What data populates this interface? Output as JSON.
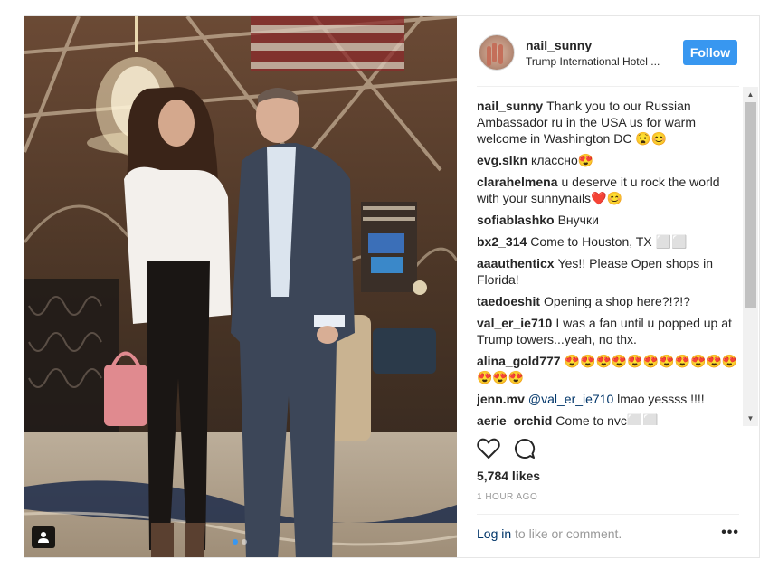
{
  "post": {
    "username": "nail_sunny",
    "location": "Trump International Hotel ...",
    "follow_label": "Follow",
    "likes": "5,784 likes",
    "timestamp": "1 HOUR AGO",
    "login_link": "Log in",
    "login_rest": " to like or comment.",
    "more_label": "•••"
  },
  "comments": [
    {
      "user": "nail_sunny",
      "text": "Thank you to our Russian Ambassador ru in the USA us for warm welcome in Washington DC 😧😊"
    },
    {
      "user": "evg.slkn",
      "text": "классно😍"
    },
    {
      "user": "clarahelmena",
      "text": "u deserve it u rock the world with your sunnynails❤️😊"
    },
    {
      "user": "sofiablashko",
      "text": "Внучки"
    },
    {
      "user": "bx2_314",
      "text": "Come to Houston, TX ⬜⬜"
    },
    {
      "user": "aaauthenticx",
      "text": "Yes!! Please Open shops in Florida!"
    },
    {
      "user": "taedoeshit",
      "text": "Opening a shop here?!?!?"
    },
    {
      "user": "val_er_ie710",
      "text": "I was a fan until u popped up at Trump towers...yeah, no thx."
    },
    {
      "user": "alina_gold777",
      "text": "😍😍😍😍😍😍😍😍😍😍😍😍😍😍"
    },
    {
      "user": "jenn.mv",
      "mention": "@val_er_ie710",
      "text": " lmao yessss !!!!"
    },
    {
      "user": "aerie_orchid",
      "text": "Come to nyc⬜⬜"
    }
  ],
  "icons": {
    "like": "heart-icon",
    "comment": "comment-bubble-icon",
    "user_tag": "person-icon"
  },
  "colors": {
    "accent": "#3897f0",
    "link": "#003569"
  }
}
